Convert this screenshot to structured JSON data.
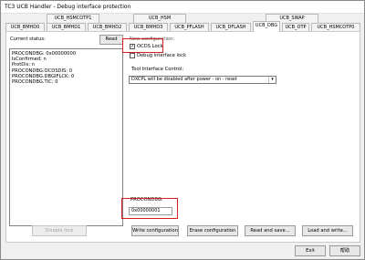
{
  "window": {
    "title": "TC3 UCB Handler - Debug interface protection"
  },
  "tabs_top": [
    {
      "label": "UCB_HSMCOTP1"
    },
    {
      "label": "UCB_HSM"
    },
    {
      "label": "UCB_SWAP"
    }
  ],
  "tabs_bottom": [
    {
      "label": "UCB_BMHD0"
    },
    {
      "label": "UCB_BMHD1"
    },
    {
      "label": "UCB_BMHD2"
    },
    {
      "label": "UCB_BMHD3"
    },
    {
      "label": "UCB_PFLASH"
    },
    {
      "label": "UCB_DFLASH"
    },
    {
      "label": "UCB_DBG"
    },
    {
      "label": "UCB_OTP"
    },
    {
      "label": "UCB_HSMCOTP0"
    }
  ],
  "status": {
    "label": "Current status:",
    "read_button": "Read",
    "lines": [
      "PROCONDBG: 0x00000000",
      "IsConfirmed: n",
      "ProtDis: n",
      "PROCONDBG.OCDSDIS: 0",
      "PROCONDBG.DBGIFLCK: 0",
      "PROCONDBG.TIC: 0"
    ]
  },
  "config": {
    "label": "New configuration:",
    "ocds_lock": {
      "label": "OCDS Lock",
      "checked": true
    },
    "debug_lock": {
      "label": "Debug interface lock",
      "checked": false
    },
    "tool_label": "Tool Interface Control:",
    "tool_value": "DXCPL will be disabled after power - on - reset",
    "procondbg_label": "PROCONDBG:",
    "procondbg_value": "0x00000001"
  },
  "buttons": {
    "disable_lock": "Disable lock",
    "write": "Write configuration",
    "erase": "Erase configuration",
    "read_save": "Read and save...",
    "load_write": "Load and write...",
    "exit": "Exit",
    "help": "帮助"
  },
  "colors": {
    "highlight": "#d81e1e"
  }
}
